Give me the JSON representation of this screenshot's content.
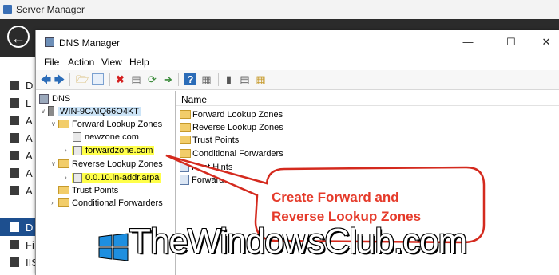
{
  "server_manager": {
    "title": "Server Manager",
    "nav_items": [
      {
        "label": "D",
        "icon": "dashboard-icon"
      },
      {
        "label": "L",
        "icon": "local-server-icon"
      },
      {
        "label": "A",
        "icon": "all-servers-icon"
      },
      {
        "label": "A",
        "icon": "ad-icon"
      },
      {
        "label": "A",
        "icon": "ad-ds-icon"
      },
      {
        "label": "A",
        "icon": "ad-lds-icon"
      },
      {
        "label": "A",
        "icon": "ad-rms-icon"
      },
      {
        "label": "D",
        "icon": "dns-icon"
      },
      {
        "label": "Fi",
        "icon": "file-services-icon"
      },
      {
        "label": "IIS",
        "icon": "iis-icon"
      }
    ]
  },
  "dns_manager": {
    "title": "DNS Manager",
    "window_buttons": {
      "minimize": "—",
      "maximize": "☐",
      "close": "✕"
    },
    "menu": [
      "File",
      "Action",
      "View",
      "Help"
    ],
    "tree": {
      "root": "DNS",
      "server": "WIN-9CAIQ66O4KT",
      "forward_zones": "Forward Lookup Zones",
      "forward_children": [
        "newzone.com",
        "forwardzone.com"
      ],
      "reverse_zones": "Reverse Lookup Zones",
      "reverse_children": [
        "0.0.10.in-addr.arpa"
      ],
      "trust_points": "Trust Points",
      "conditional_forwarders": "Conditional Forwarders"
    },
    "list": {
      "column_name": "Name",
      "items": [
        {
          "label": "Forward Lookup Zones",
          "icon": "folder-icon"
        },
        {
          "label": "Reverse Lookup Zones",
          "icon": "folder-icon"
        },
        {
          "label": "Trust Points",
          "icon": "folder-icon"
        },
        {
          "label": "Conditional Forwarders",
          "icon": "folder-icon"
        },
        {
          "label": "Root Hints",
          "icon": "root-hints-icon"
        },
        {
          "label": "Forwarders",
          "icon": "forwarders-icon"
        }
      ]
    }
  },
  "callout": {
    "line1": "Create Forward and",
    "line2": "Reverse Lookup Zones",
    "color": "#e53a2a"
  },
  "watermark": {
    "text": "TheWindowsClub.com"
  },
  "colors": {
    "highlight": "#ffff4a",
    "selected": "#cce4f7",
    "header_dark": "#2b2b2b",
    "nav_active": "#1d4f8f"
  }
}
